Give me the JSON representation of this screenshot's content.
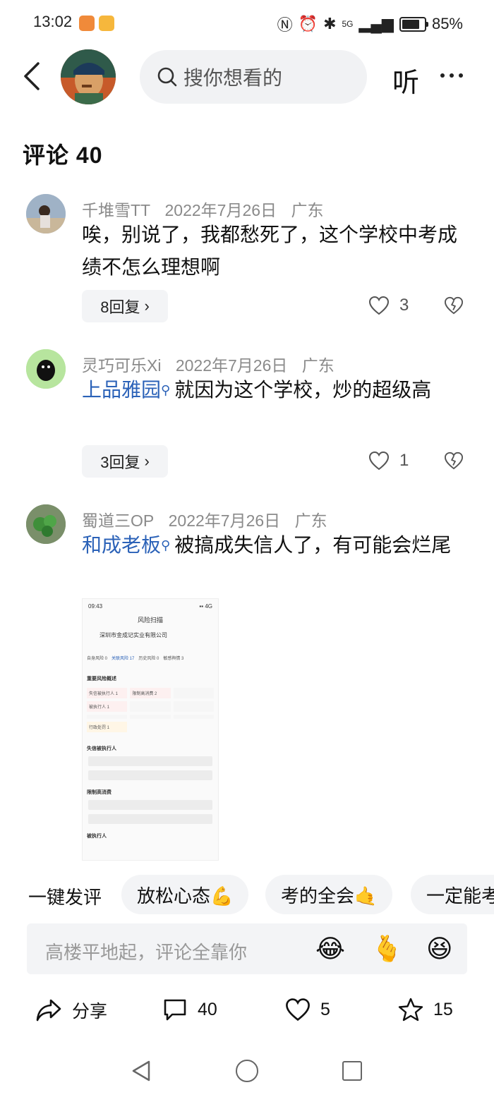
{
  "status_bar": {
    "time": "13:02",
    "battery": "85%",
    "network": "5G"
  },
  "header": {
    "search_placeholder": "搜你想看的",
    "listen_label": "听"
  },
  "comments_title": "评论 40",
  "comments": [
    {
      "user": "千堆雪TT",
      "date": "2022年7月26日",
      "location": "广东",
      "text": "唉，别说了，我都愁死了，这个学校中考成绩不怎么理想啊",
      "replies_label": "8回复",
      "likes": "3"
    },
    {
      "user": "灵巧可乐Xi",
      "date": "2022年7月26日",
      "location": "广东",
      "link_text": "上品雅园",
      "text": "就因为这个学校，炒的超级高",
      "replies_label": "3回复",
      "likes": "1"
    },
    {
      "user": "蜀道三OP",
      "date": "2022年7月26日",
      "location": "广东",
      "link_text": "和成老板",
      "text": "被搞成失信人了，有可能会烂尾"
    }
  ],
  "screenshot": {
    "time": "09:43",
    "title": "风险扫描",
    "company": "深圳市金成记实业有限公司",
    "tabs": [
      "自身风险 0",
      "关联风险 17",
      "历史风险 0",
      "敏感舆情 3"
    ],
    "section": "重要风险概述",
    "items": [
      "失信被执行人 1",
      "限制高消费 2",
      "被执行人 1",
      "行政处罚 1"
    ],
    "heading1": "失信被执行人",
    "heading2": "限制高消费",
    "heading3": "被执行人"
  },
  "quick_replies": {
    "label": "一键发评",
    "chips": [
      "放松心态💪",
      "考的全会🤙",
      "一定能考"
    ]
  },
  "input": {
    "placeholder": "高楼平地起，评论全靠你",
    "emojis": [
      "😂",
      "🫰",
      "😆"
    ]
  },
  "actions": {
    "share": "分享",
    "comments": "40",
    "likes": "5",
    "favorites": "15"
  }
}
